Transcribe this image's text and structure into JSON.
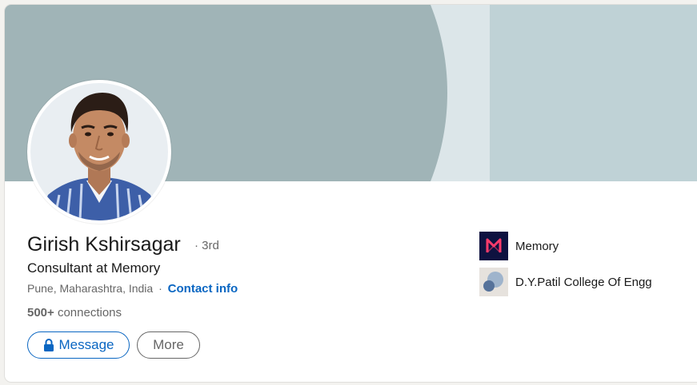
{
  "profile": {
    "name": "Girish Kshirsagar",
    "degree": "· 3rd",
    "headline": "Consultant at Memory",
    "location": "Pune, Maharashtra, India",
    "separator": "·",
    "contact_link": "Contact info",
    "connections_count": "500+",
    "connections_label": "connections"
  },
  "actions": {
    "message_label": "Message",
    "more_label": "More"
  },
  "sidebar": {
    "items": [
      {
        "label": "Memory",
        "icon": "memory-logo-icon"
      },
      {
        "label": "D.Y.Patil College Of Engg",
        "icon": "college-logo-icon"
      }
    ]
  },
  "colors": {
    "accent": "#0a66c2",
    "cover_primary": "#a0b4b7",
    "cover_light": "#dce6e9",
    "cover_right": "#bfd2d6",
    "memory_logo_bg": "#0e1240",
    "memory_logo_fg": "#ff3b6b"
  }
}
